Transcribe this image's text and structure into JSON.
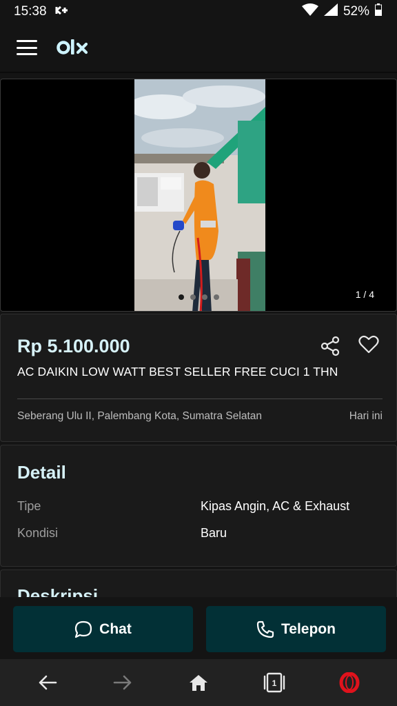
{
  "status": {
    "time": "15:38",
    "battery": "52%"
  },
  "app": {
    "brand": "OLX"
  },
  "gallery": {
    "counter": "1 / 4",
    "total": 4,
    "active": 0
  },
  "listing": {
    "price": "Rp 5.100.000",
    "title": "AC DAIKIN LOW WATT BEST SELLER FREE CUCI 1 THN",
    "location": "Seberang Ulu II, Palembang Kota, Sumatra Selatan",
    "date": "Hari ini"
  },
  "detail": {
    "heading": "Detail",
    "rows": [
      {
        "label": "Tipe",
        "value": "Kipas Angin, AC & Exhaust"
      },
      {
        "label": "Kondisi",
        "value": "Baru"
      }
    ]
  },
  "description": {
    "heading": "Deskripsi"
  },
  "actions": {
    "chat_label": "Chat",
    "call_label": "Telepon"
  },
  "nav": {
    "tabs_count": "1"
  },
  "colors": {
    "accent": "#023036",
    "heading": "#d6f1f7",
    "background": "#141414",
    "opera_red": "#e0121c"
  }
}
